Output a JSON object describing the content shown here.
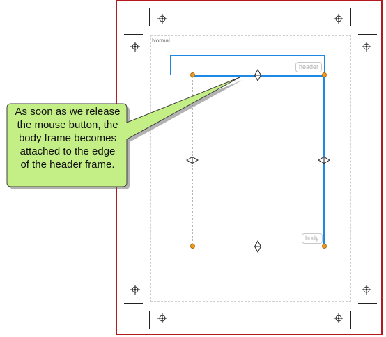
{
  "page": {
    "name": "Normal",
    "frames": {
      "header_label": "header",
      "body_label": "body"
    }
  },
  "callout": {
    "line1": "As soon as we release",
    "line2": "the mouse button, the",
    "line3": "body frame becomes",
    "line4": "attached to the edge",
    "line5": "of the header frame."
  },
  "icons": {
    "registration": "registration-mark-icon",
    "resize_vertical": "resize-vertical-icon",
    "resize_horizontal": "resize-horizontal-icon"
  },
  "colors": {
    "sheet_border": "#b3191e",
    "frame_selection": "#1e88e5",
    "handle": "#f39a1d",
    "callout_fill": "#c4ee86",
    "callout_border": "#3f3f3f"
  }
}
